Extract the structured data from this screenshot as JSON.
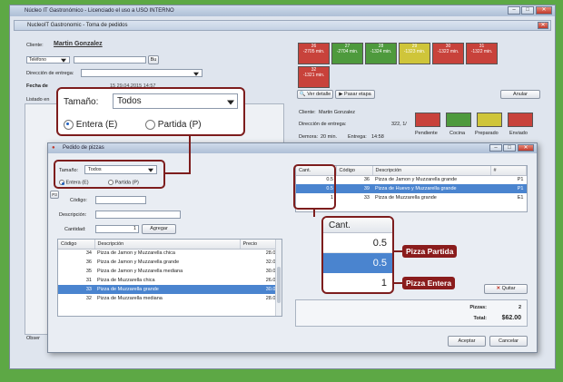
{
  "main_window": {
    "title": "Núcleo IT Gastronómico - Licenciado el uso a USO INTERNO",
    "child_title": "NucleoIT Gastronomic - Toma de pedidos",
    "cliente_label": "Cliente:",
    "cliente_value": "Martin Gonzalez",
    "telefono_value": "Teléfono",
    "buscar_button": "Bu",
    "direccion_label": "Dirección de entrega:",
    "fecha_label": "Fecha de",
    "fecha_value": "15 29.04.2015 14:57",
    "listado_label": "Listado en",
    "observ_label": "Obser",
    "ver_detalle_button": "Ver detalle",
    "pasar_etapa_button": "Pasar etapa",
    "anular_button": "Anular",
    "detail_cliente_label": "Cliente:",
    "detail_cliente_value": "Martin Gonzalez",
    "detail_direccion_label": "Dirección de entrega:",
    "detail_direccion_value": "322, 1/",
    "demora_label": "Demora:",
    "demora_value": "20 min.",
    "entrega_label": "Entrega:",
    "entrega_value": "14:58",
    "stages": [
      "Pendiente",
      "Cocina",
      "Preparado",
      "Enviado"
    ],
    "timers": [
      {
        "num": "26",
        "time": "-2705 min.",
        "color": "#c8423b"
      },
      {
        "num": "27",
        "time": "-2704 min.",
        "color": "#4e9a3d"
      },
      {
        "num": "28",
        "time": "-1324 min.",
        "color": "#4e9a3d"
      },
      {
        "num": "29",
        "time": "-1323 min.",
        "color": "#cfc53a"
      },
      {
        "num": "30",
        "time": "-1322 min.",
        "color": "#c8423b"
      },
      {
        "num": "31",
        "time": "-1322 min.",
        "color": "#c8423b"
      },
      {
        "num": "32",
        "time": "-1321 min.",
        "color": "#c8423b"
      }
    ]
  },
  "dialog": {
    "title": "Pedido de pizzas",
    "tamano_label": "Tamaño:",
    "tamano_value": "Todos",
    "entera_label": "Entera (E)",
    "partida_label": "Partida (P)",
    "p3_label": "P3",
    "codigo_label": "Código:",
    "descripcion_label": "Descripción:",
    "cantidad_label": "Cantidad:",
    "cantidad_value": "1",
    "agregar_button": "Agregar",
    "product_headers": [
      "Código",
      "Descripción",
      "Precio"
    ],
    "products": [
      {
        "codigo": "34",
        "descripcion": "Pizza de Jamon y Muzzarella chica",
        "precio": "28.00",
        "selected": false
      },
      {
        "codigo": "36",
        "descripcion": "Pizza de Jamon y Muzzarella grande",
        "precio": "32.00",
        "selected": false
      },
      {
        "codigo": "35",
        "descripcion": "Pizza de Jamon y Muzzarella mediana",
        "precio": "30.00",
        "selected": false
      },
      {
        "codigo": "31",
        "descripcion": "Pizza de Muzzarella chica",
        "precio": "26.00",
        "selected": false
      },
      {
        "codigo": "33",
        "descripcion": "Pizza de Muzzarella grande",
        "precio": "30.00",
        "selected": true
      },
      {
        "codigo": "32",
        "descripcion": "Pizza de Muzzarella mediana",
        "precio": "28.00",
        "selected": false
      }
    ],
    "order_headers": [
      "Cant.",
      "Código",
      "Descripción",
      "#"
    ],
    "orders": [
      {
        "cant": "0.5",
        "codigo": "36",
        "descripcion": "Pizza de Jamon y Muzzarella grande",
        "num": "P1",
        "selected": false
      },
      {
        "cant": "0.5",
        "codigo": "39",
        "descripcion": "Pizza de Huevo y Muzzarella grande",
        "num": "P1",
        "selected": true
      },
      {
        "cant": "1",
        "codigo": "33",
        "descripcion": "Pizza de Muzzarella grande",
        "num": "E1",
        "selected": false
      }
    ],
    "quitar_button": "Quitar",
    "pizzas_label": "Pizzas:",
    "pizzas_value": "2",
    "total_label": "Total:",
    "total_value": "$62.00",
    "aceptar_button": "Aceptar",
    "cancelar_button": "Cancelar"
  },
  "zoom_tamano": {
    "label": "Tamaño:",
    "value": "Todos",
    "entera": "Entera (E)",
    "partida": "Partida (P)"
  },
  "zoom_cant": {
    "header": "Cant.",
    "values": [
      "0.5",
      "0.5",
      "1"
    ]
  },
  "callouts": {
    "partida": "Pizza Partida",
    "entera": "Pizza Entera"
  }
}
